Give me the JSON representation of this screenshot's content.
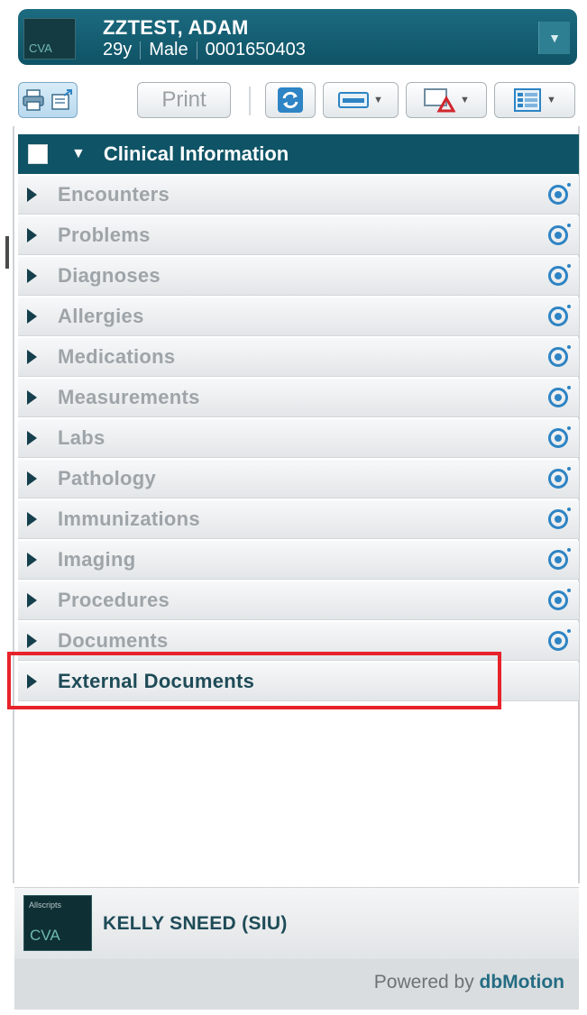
{
  "patient": {
    "name": "ZZTEST, ADAM",
    "age": "29y",
    "sex": "Male",
    "id": "0001650403",
    "logo_text": "CVA"
  },
  "toolbar": {
    "print_label": "Print"
  },
  "section": {
    "title": "Clinical Information"
  },
  "categories": [
    {
      "label": "Encounters"
    },
    {
      "label": "Problems"
    },
    {
      "label": "Diagnoses"
    },
    {
      "label": "Allergies"
    },
    {
      "label": "Medications"
    },
    {
      "label": "Measurements"
    },
    {
      "label": "Labs"
    },
    {
      "label": "Pathology"
    },
    {
      "label": "Immunizations"
    },
    {
      "label": "Imaging"
    },
    {
      "label": "Procedures"
    },
    {
      "label": "Documents"
    },
    {
      "label": "External Documents"
    }
  ],
  "user": {
    "name": "KELLY SNEED (SIU)",
    "logo_small": "Allscripts",
    "logo_text": "CVA"
  },
  "footer": {
    "powered_prefix": "Powered by ",
    "powered_brand": "dbMotion"
  },
  "colors": {
    "header_bg": "#0f5366",
    "highlight": "#e8222a",
    "eye_icon": "#2e84c4"
  }
}
